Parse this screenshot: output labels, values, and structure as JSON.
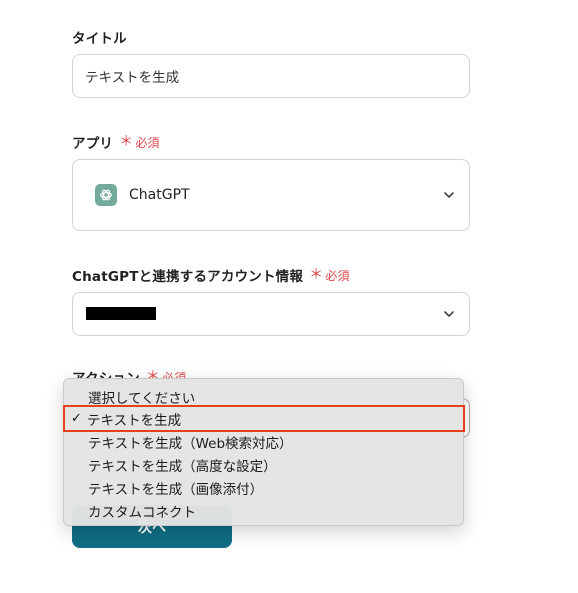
{
  "title_field": {
    "label": "タイトル",
    "value": "テキストを生成"
  },
  "app_field": {
    "label": "アプリ",
    "required_mark": "＊",
    "required_text": "必須",
    "app_name": "ChatGPT",
    "app_icon": "openai-logo-icon"
  },
  "account_field": {
    "label": "ChatGPTと連携するアカウント情報",
    "required_mark": "＊",
    "required_text": "必須"
  },
  "action_field": {
    "label": "アクション",
    "required_mark": "＊",
    "required_text": "必須"
  },
  "action_menu": {
    "check_mark": "✓",
    "items": [
      "選択してください",
      "テキストを生成",
      "テキストを生成（Web検索対応）",
      "テキストを生成（高度な設定）",
      "テキストを生成（画像添付）",
      "カスタムコネクト"
    ],
    "selected": "テキストを生成"
  },
  "next_button": {
    "label": "次へ"
  },
  "colors": {
    "primary_button": "#0f6e86",
    "required": "#e0474b",
    "highlight_border": "#e8401c",
    "chatgpt_brand": "#74aa9c"
  }
}
